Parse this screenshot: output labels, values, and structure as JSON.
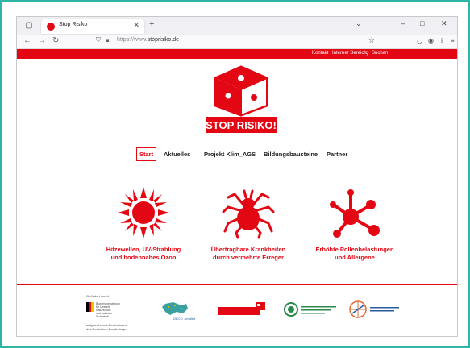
{
  "browser": {
    "tab_title": "Stop Risiko",
    "url_protocol": "https://www.",
    "url_domain": "stoprisiko.de"
  },
  "topbar": {
    "links": [
      "Kontakt",
      "Interner Bereich",
      "Suchen"
    ]
  },
  "logo": {
    "text": "STOP RISIKO!"
  },
  "nav": {
    "items": [
      "Start",
      "Aktuelles",
      "Projekt Klim_AGS",
      "Bildungsbausteine",
      "Partner"
    ],
    "active": "Start"
  },
  "features": [
    {
      "icon": "sun-icon",
      "line1": "Hitzewellen, UV-Strahlung",
      "line2": "und bodennahes Ozon"
    },
    {
      "icon": "tick-icon",
      "line1": "Übertragbare Krankheiten",
      "line2": "durch vermehrte Erreger"
    },
    {
      "icon": "pollen-icon",
      "line1": "Erhöhte Pollenbelastungen",
      "line2": "und Allergene"
    }
  ],
  "footer": {
    "funded_by": "Gefördert durch:",
    "ministry": [
      "Bundesministerium",
      "für Umwelt, Naturschutz",
      "und nukleare Sicherheit"
    ],
    "resolution": [
      "aufgrund eines Beschlusses",
      "des Deutschen Bundestages"
    ],
    "deco": "DECO - Institut"
  },
  "colors": {
    "brand_red": "#e30613",
    "frame": "#2fb5a6"
  }
}
